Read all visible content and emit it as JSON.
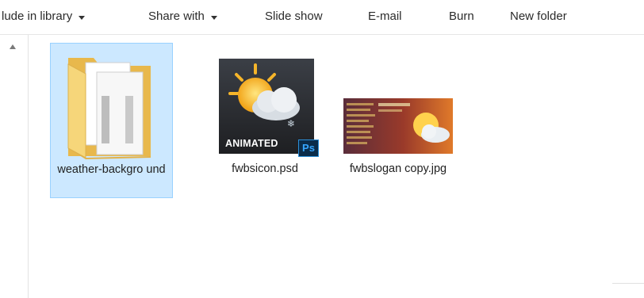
{
  "toolbar": {
    "items": [
      {
        "label": "lude in library",
        "has_dropdown": true
      },
      {
        "label": "Share with",
        "has_dropdown": true
      },
      {
        "label": "Slide show",
        "has_dropdown": false
      },
      {
        "label": "E-mail",
        "has_dropdown": false
      },
      {
        "label": "Burn",
        "has_dropdown": false
      },
      {
        "label": "New folder",
        "has_dropdown": false
      }
    ]
  },
  "files": [
    {
      "name": "weather-backgro und",
      "type": "folder",
      "selected": true,
      "icon": "folder-icon"
    },
    {
      "name": "fwbsicon.psd",
      "type": "psd",
      "selected": false,
      "icon": "psd-thumbnail",
      "overlay_text": "ANIMATED",
      "badge": "Ps"
    },
    {
      "name": "fwbslogan copy.jpg",
      "type": "jpg",
      "selected": false,
      "icon": "jpg-thumbnail"
    }
  ],
  "colors": {
    "selection_bg": "#cce8ff",
    "selection_border": "#99d1ff",
    "folder": "#f5d77e"
  }
}
